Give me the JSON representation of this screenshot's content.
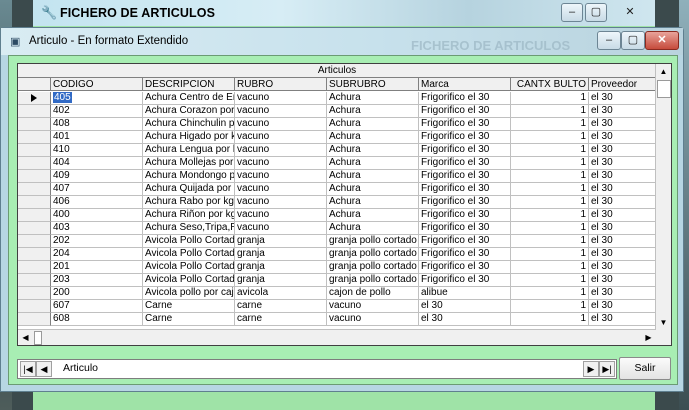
{
  "outer_window": {
    "title": "FICHERO DE ARTICULOS",
    "buttons": [
      "‒",
      "▢",
      "✕"
    ]
  },
  "inner_window": {
    "title": "Articulo - En formato Extendido",
    "ghost_title": "FICHERO DE ARTICULOS",
    "buttons": [
      "‒",
      "▢",
      "✕"
    ]
  },
  "grid": {
    "caption": "Articulos",
    "columns": [
      "CODIGO",
      "DESCRIPCION",
      "RUBRO",
      "SUBRUBRO",
      "Marca",
      "CANTX BULTO",
      "Proveedor"
    ],
    "rows": [
      [
        "405",
        "Achura Centro de Entraña",
        "vacuno",
        "Achura",
        "Frigorifico el 30",
        "1",
        "el 30"
      ],
      [
        "402",
        "Achura Corazon por kg",
        "vacuno",
        "Achura",
        "Frigorifico el 30",
        "1",
        "el 30"
      ],
      [
        "408",
        "Achura Chinchulin por kg",
        "vacuno",
        "Achura",
        "Frigorifico el 30",
        "1",
        "el 30"
      ],
      [
        "401",
        "Achura Higado por kg",
        "vacuno",
        "Achura",
        "Frigorifico el 30",
        "1",
        "el 30"
      ],
      [
        "410",
        "Achura Lengua por kg",
        "vacuno",
        "Achura",
        "Frigorifico el 30",
        "1",
        "el 30"
      ],
      [
        "404",
        "Achura Mollejas por kg",
        "vacuno",
        "Achura",
        "Frigorifico el 30",
        "1",
        "el 30"
      ],
      [
        "409",
        "Achura Mondongo por kg",
        "vacuno",
        "Achura",
        "Frigorifico el 30",
        "1",
        "el 30"
      ],
      [
        "407",
        "Achura Quijada por kg",
        "vacuno",
        "Achura",
        "Frigorifico el 30",
        "1",
        "el 30"
      ],
      [
        "406",
        "Achura Rabo por kg",
        "vacuno",
        "Achura",
        "Frigorifico el 30",
        "1",
        "el 30"
      ],
      [
        "400",
        "Achura Riñon por kg",
        "vacuno",
        "Achura",
        "Frigorifico el 30",
        "1",
        "el 30"
      ],
      [
        "403",
        "Achura Seso,Tripa,Riñon",
        "vacuno",
        "Achura",
        "Frigorifico el 30",
        "1",
        "el 30"
      ],
      [
        "202",
        "Avicola Pollo Cortado",
        "granja",
        "granja pollo cortado",
        "Frigorifico el 30",
        "1",
        "el 30"
      ],
      [
        "204",
        "Avicola Pollo Cortado",
        "granja",
        "granja pollo cortado",
        "Frigorifico el 30",
        "1",
        "el 30"
      ],
      [
        "201",
        "Avicola Pollo Cortado",
        "granja",
        "granja pollo cortado",
        "Frigorifico el 30",
        "1",
        "el 30"
      ],
      [
        "203",
        "Avicola Pollo Cortado",
        "granja",
        "granja pollo cortado",
        "Frigorifico el 30",
        "1",
        "el 30"
      ],
      [
        "200",
        "Avicola pollo por cajon",
        "avicola",
        "cajon de pollo",
        "alibue",
        "1",
        "el 30"
      ],
      [
        "607",
        "Carne",
        "carne",
        "vacuno",
        "el 30",
        "1",
        "el 30"
      ],
      [
        "608",
        "Carne",
        "carne",
        "vacuno",
        "el 30",
        "1",
        "el 30"
      ]
    ]
  },
  "navigator": {
    "label": "Articulo",
    "first": "|◀",
    "prev": "◀",
    "next": "▶",
    "last": "▶|"
  },
  "buttons": {
    "exit_label": "Salir"
  },
  "colors": {
    "client_bg": "#a8eeb3",
    "selection": "#316ac5"
  }
}
